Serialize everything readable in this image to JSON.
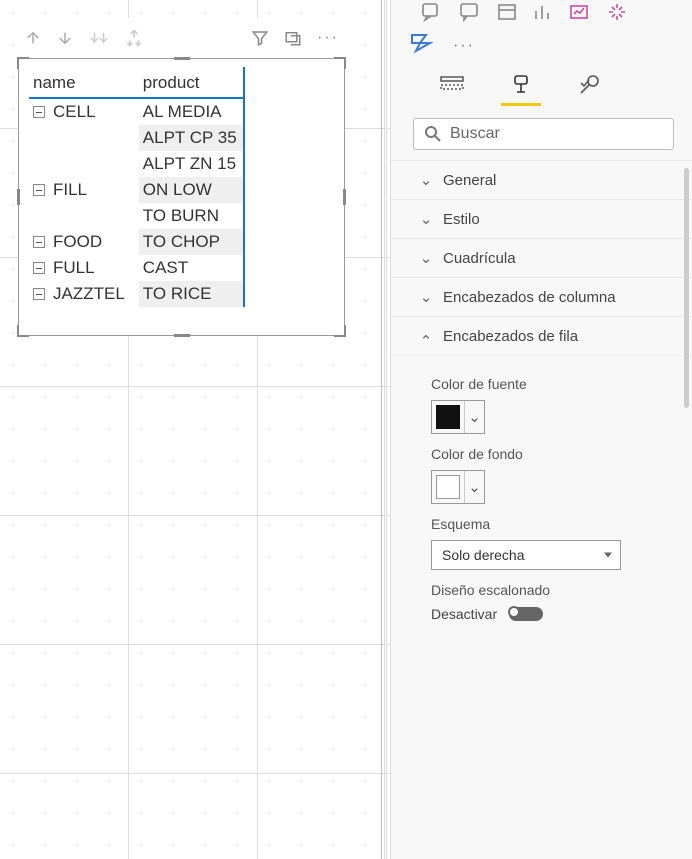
{
  "matrix": {
    "headers": {
      "name": "name",
      "product": "product"
    },
    "rows": [
      {
        "name": "CELL",
        "product": "AL MEDIA",
        "alt": false
      },
      {
        "name": "",
        "product": "ALPT CP 35",
        "alt": true
      },
      {
        "name": "",
        "product": "ALPT ZN 15",
        "alt": false
      },
      {
        "name": "FILL",
        "product": "ON LOW",
        "alt": true
      },
      {
        "name": "",
        "product": "TO BURN",
        "alt": false
      },
      {
        "name": "FOOD",
        "product": "TO CHOP",
        "alt": true
      },
      {
        "name": "FULL",
        "product": "CAST",
        "alt": false
      },
      {
        "name": "JAZZTEL",
        "product": "TO RICE",
        "alt": true
      }
    ]
  },
  "search": {
    "placeholder": "Buscar"
  },
  "accordion": {
    "general": "General",
    "style": "Estilo",
    "grid": "Cuadrícula",
    "colHeaders": "Encabezados de columna",
    "rowHeaders": "Encabezados de fila"
  },
  "rowHeaders": {
    "fontColorLabel": "Color de fuente",
    "bgColorLabel": "Color de fondo",
    "outlineLabel": "Esquema",
    "outlineValue": "Solo derecha",
    "steppedLabel": "Diseño escalonado",
    "toggleOffLabel": "Desactivar"
  },
  "chart_data": {
    "type": "table",
    "columns": [
      "name",
      "product"
    ],
    "rows": [
      [
        "CELL",
        "AL MEDIA"
      ],
      [
        "CELL",
        "ALPT CP 35"
      ],
      [
        "CELL",
        "ALPT ZN 15"
      ],
      [
        "FILL",
        "ON LOW"
      ],
      [
        "FILL",
        "TO BURN"
      ],
      [
        "FOOD",
        "TO CHOP"
      ],
      [
        "FULL",
        "CAST"
      ],
      [
        "JAZZTEL",
        "TO RICE"
      ]
    ]
  }
}
